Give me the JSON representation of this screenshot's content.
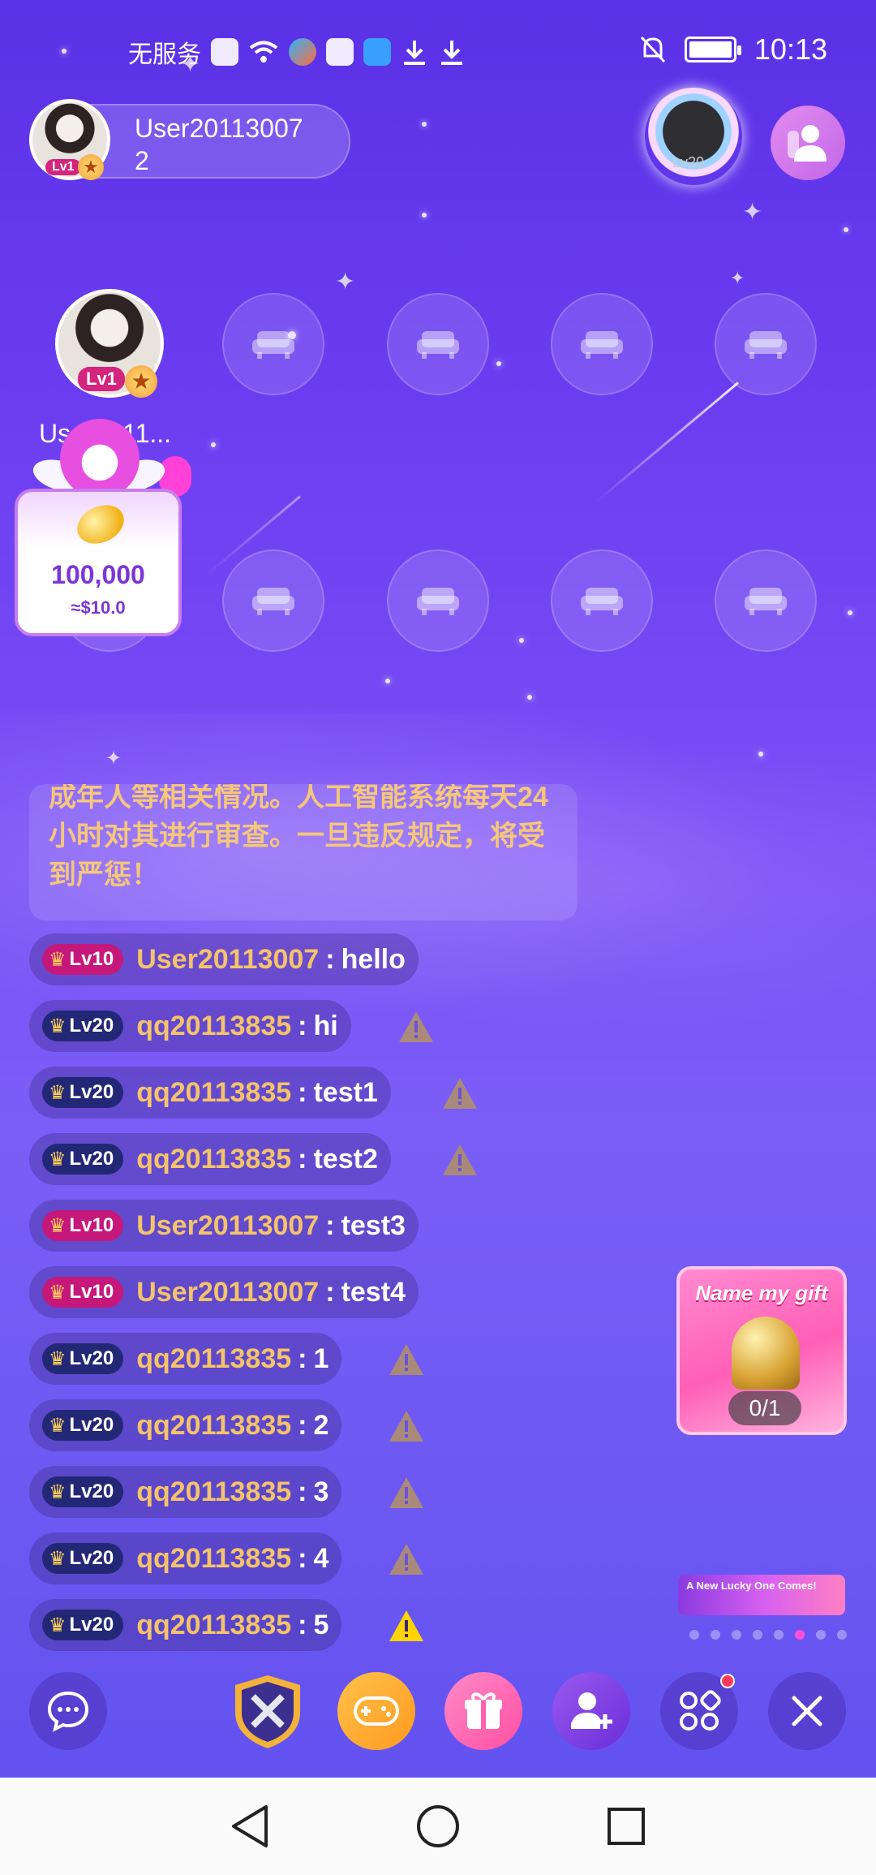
{
  "status_bar": {
    "carrier": "无服务",
    "time": "10:13"
  },
  "host": {
    "name": "User20113007\n2",
    "level_badge": "Lv1"
  },
  "top_frame_level": "Lv20",
  "seats": {
    "host_seat_name": "User2011...",
    "host_seat_level": "Lv1",
    "empty_seat_icon": "sofa-icon"
  },
  "gift_popup": {
    "amount": "100,000",
    "usd": "≈$10.0"
  },
  "notice": {
    "text": "成年人等相关情况。人工智能系统每天24 小时对其进行审查。一旦违反规定，将受到严惩！"
  },
  "messages": [
    {
      "level": "Lv10",
      "user": "User20113007",
      "text": "hello",
      "warning": false
    },
    {
      "level": "Lv20",
      "user": "qq20113835",
      "text": "hi",
      "warning": true
    },
    {
      "level": "Lv20",
      "user": "qq20113835",
      "text": "test1",
      "warning": true
    },
    {
      "level": "Lv20",
      "user": "qq20113835",
      "text": "test2",
      "warning": true
    },
    {
      "level": "Lv10",
      "user": "User20113007",
      "text": "test3",
      "warning": false
    },
    {
      "level": "Lv10",
      "user": "User20113007",
      "text": "test4",
      "warning": false
    },
    {
      "level": "Lv20",
      "user": "qq20113835",
      "text": "1",
      "warning": true
    },
    {
      "level": "Lv20",
      "user": "qq20113835",
      "text": "2",
      "warning": true
    },
    {
      "level": "Lv20",
      "user": "qq20113835",
      "text": "3",
      "warning": true
    },
    {
      "level": "Lv20",
      "user": "qq20113835",
      "text": "4",
      "warning": true
    },
    {
      "level": "Lv20",
      "user": "qq20113835",
      "text": "5",
      "warning": true
    }
  ],
  "name_my_gift": {
    "title": "Name my gift",
    "progress": "0/1"
  },
  "lucky_banner": {
    "text": "A New Lucky One Comes!"
  },
  "toolbar": {
    "chat": "chat-bubble-icon",
    "battle": "battle-shield-icon",
    "game": "gamepad-icon",
    "gift": "gift-icon",
    "add_user": "add-user-icon",
    "apps": "apps-grid-icon",
    "close": "close-icon"
  },
  "colors": {
    "background_top": "#5a31e6",
    "background_bottom": "#5f50ef",
    "username_gold": "#f4c36a",
    "lv10_badge": "#c5187a",
    "lv20_badge": "#232876",
    "warning_active": "#ffd400",
    "warning_muted": "#a98a7a"
  }
}
